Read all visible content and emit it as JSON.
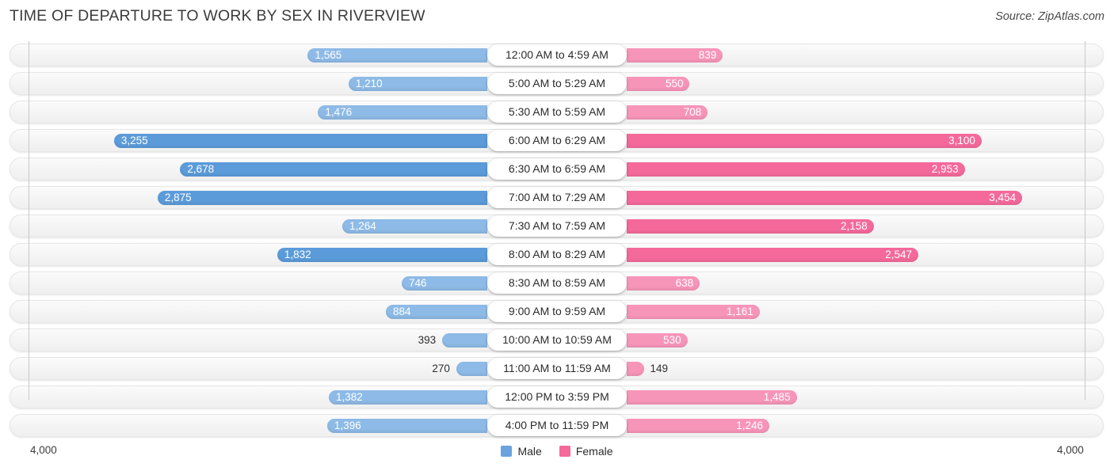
{
  "header": {
    "title": "TIME OF DEPARTURE TO WORK BY SEX IN RIVERVIEW",
    "source": "Source: ZipAtlas.com"
  },
  "axis": {
    "left_max_label": "4,000",
    "right_max_label": "4,000"
  },
  "legend": {
    "items": [
      {
        "label": "Male",
        "color": "#6aa3dd"
      },
      {
        "label": "Female",
        "color": "#f4699a"
      }
    ]
  },
  "colors": {
    "male_light": "#8dbae6",
    "male_dark": "#5b9bd9",
    "female_light": "#f795b8",
    "female_dark": "#f4699a",
    "track": "#f2f2f2",
    "gridline": "#c8c8c8"
  },
  "chart_data": {
    "type": "bar",
    "subtype": "diverging-tornado",
    "title": "TIME OF DEPARTURE TO WORK BY SEX IN RIVERVIEW",
    "xlabel": "",
    "ylabel": "",
    "xlim": [
      0,
      4000
    ],
    "grid": true,
    "legend_position": "bottom-center",
    "categories": [
      "12:00 AM to 4:59 AM",
      "5:00 AM to 5:29 AM",
      "5:30 AM to 5:59 AM",
      "6:00 AM to 6:29 AM",
      "6:30 AM to 6:59 AM",
      "7:00 AM to 7:29 AM",
      "7:30 AM to 7:59 AM",
      "8:00 AM to 8:29 AM",
      "8:30 AM to 8:59 AM",
      "9:00 AM to 9:59 AM",
      "10:00 AM to 10:59 AM",
      "11:00 AM to 11:59 AM",
      "12:00 PM to 3:59 PM",
      "4:00 PM to 11:59 PM"
    ],
    "series": [
      {
        "name": "Male",
        "side": "left",
        "values": [
          1565,
          1210,
          1476,
          3255,
          2678,
          2875,
          1264,
          1832,
          746,
          884,
          393,
          270,
          1382,
          1396
        ],
        "labels": [
          "1,565",
          "1,210",
          "1,476",
          "3,255",
          "2,678",
          "2,875",
          "1,264",
          "1,832",
          "746",
          "884",
          "393",
          "270",
          "1,382",
          "1,396"
        ]
      },
      {
        "name": "Female",
        "side": "right",
        "values": [
          839,
          550,
          708,
          3100,
          2953,
          3454,
          2158,
          2547,
          638,
          1161,
          530,
          149,
          1485,
          1246
        ],
        "labels": [
          "839",
          "550",
          "708",
          "3,100",
          "2,953",
          "3,454",
          "2,158",
          "2,547",
          "638",
          "1,161",
          "530",
          "149",
          "1,485",
          "1,246"
        ]
      }
    ]
  }
}
